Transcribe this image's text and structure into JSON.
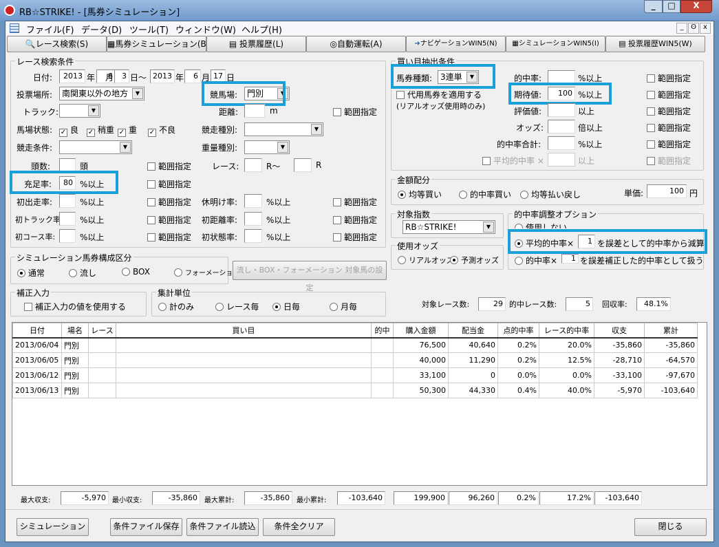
{
  "window": {
    "title": "RB☆STRIKE! - [馬券シミュレーション]",
    "app_icon": "rb-logo-icon",
    "controls": [
      "minimize",
      "maximize",
      "close"
    ]
  },
  "menu": [
    "ファイル(F)",
    "データ(D)",
    "ツール(T)",
    "ウィンドウ(W)",
    "ヘルプ(H)"
  ],
  "toolbar": [
    {
      "label": "レース検索(S)",
      "icon": "search-icon"
    },
    {
      "label": "馬券シミュレーション(B)",
      "icon": "grid-icon"
    },
    {
      "label": "投票履歴(L)",
      "icon": "document-icon"
    },
    {
      "label": "自動運転(A)",
      "icon": "clock-icon"
    },
    {
      "label": "ナビゲーションWIN5(N)",
      "icon": "arrow-icon"
    },
    {
      "label": "シミュレーションWIN5(I)",
      "icon": "grid-icon"
    },
    {
      "label": "投票履歴WIN5(W)",
      "icon": "document-icon"
    }
  ],
  "race": {
    "title": "レース検索条件",
    "date_label": "日付:",
    "y1": "2013",
    "m1": "6",
    "d1": "3",
    "y2": "2013",
    "m2": "6",
    "d2": "17",
    "nen": "年",
    "tsuki": "月",
    "hi_from": "日～",
    "hi": "日",
    "venue_label": "投票場所:",
    "venue": "南関東以外の地方",
    "track_label": "競馬場:",
    "track": "門別",
    "course_label": "トラック:",
    "dist_label": "距離:",
    "dist_unit": "m",
    "range": "範囲指定",
    "cond_label": "馬場状態:",
    "conds": [
      "良",
      "稍重",
      "重",
      "不良"
    ],
    "type_label": "競走種別:",
    "race_cond_label": "競走条件:",
    "weight_label": "重量種別:",
    "heads_label": "頭数:",
    "heads_unit": "頭",
    "race_label": "レース:",
    "r_from": "R～",
    "r": "R",
    "fill_label": "充足率:",
    "fill": "80",
    "pct": "%以上",
    "first_run": "初出走率:",
    "rest": "休明け率:",
    "first_track": "初トラック率:",
    "first_dist": "初距離率:",
    "first_course": "初コース率:",
    "first_cond": "初状態率:"
  },
  "buy": {
    "title": "買い目抽出条件",
    "kind_label": "馬券種類:",
    "kind": "3連単",
    "subst": "代用馬券を適用する",
    "subst_note": "(リアルオッズ使用時のみ)",
    "hit_label": "的中率:",
    "ev_label": "期待値:",
    "ev": "100",
    "score_label": "評価値:",
    "odds_label": "オッズ:",
    "hit_sum_label": "的中率合計:",
    "avg_label": "平均的中率 ×",
    "pct": "%以上",
    "above": "以上",
    "odds_above": "倍以上",
    "range": "範囲指定"
  },
  "alloc": {
    "title": "金額配分",
    "opts": [
      "均等買い",
      "的中率買い",
      "均等払い戻し"
    ],
    "selected": 0,
    "unit_label": "単価:",
    "unit": "100",
    "yen": "円"
  },
  "index": {
    "title": "対象指数",
    "value": "RB☆STRIKE!"
  },
  "odds": {
    "title": "使用オッズ",
    "opts": [
      "リアルオッズ",
      "予測オッズ"
    ],
    "selected": 1
  },
  "adjust": {
    "title": "的中率調整オプション",
    "opt0": "使用しない",
    "opt1a": "平均的中率×",
    "opt1v": "1",
    "opt1b": "を誤差として的中率から減算",
    "opt2a": "的中率×",
    "opt2v": "1",
    "opt2b": "を誤差補正した的中率として扱う",
    "selected": 1
  },
  "comp": {
    "title": "シミュレーション馬券構成区分",
    "opts": [
      "通常",
      "流し",
      "BOX",
      "フォーメーション"
    ],
    "selected": 0,
    "button": "流し・BOX・フォーメーション 対象馬の設定"
  },
  "correct": {
    "title": "補正入力",
    "label": "補正入力の値を使用する"
  },
  "agg": {
    "title": "集計単位",
    "opts": [
      "計のみ",
      "レース毎",
      "日毎",
      "月毎"
    ],
    "selected": 2
  },
  "counts": {
    "races_label": "対象レース数:",
    "races": "29",
    "hits_label": "的中レース数:",
    "hits": "5",
    "rec_label": "回収率:",
    "rec": "48.1%"
  },
  "table": {
    "headers": [
      "日付",
      "場名",
      "レース",
      "買い目",
      "的中",
      "購入金額",
      "配当金",
      "点的中率",
      "レース的中率",
      "収支",
      "累計"
    ],
    "rows": [
      [
        "2013/06/04",
        "門別",
        "",
        "",
        "",
        "76,500",
        "40,640",
        "0.2%",
        "20.0%",
        "-35,860",
        "-35,860"
      ],
      [
        "2013/06/05",
        "門別",
        "",
        "",
        "",
        "40,000",
        "11,290",
        "0.2%",
        "12.5%",
        "-28,710",
        "-64,570"
      ],
      [
        "2013/06/12",
        "門別",
        "",
        "",
        "",
        "33,100",
        "0",
        "0.0%",
        "0.0%",
        "-33,100",
        "-97,670"
      ],
      [
        "2013/06/13",
        "門別",
        "",
        "",
        "",
        "50,300",
        "44,330",
        "0.4%",
        "40.0%",
        "-5,970",
        "-103,640"
      ]
    ]
  },
  "summary": {
    "max_bal_label": "最大収支:",
    "max_bal": "-5,970",
    "min_bal_label": "最小収支:",
    "min_bal": "-35,860",
    "max_cum_label": "最大累計:",
    "max_cum": "-35,860",
    "min_cum_label": "最小累計:",
    "min_cum": "-103,640",
    "totals": [
      "199,900",
      "96,260",
      "0.2%",
      "17.2%",
      "-103,640"
    ]
  },
  "buttons": {
    "simulate": "シミュレーション",
    "save": "条件ファイル保存",
    "load": "条件ファイル読込",
    "clear": "条件全クリア",
    "close": "閉じる"
  }
}
